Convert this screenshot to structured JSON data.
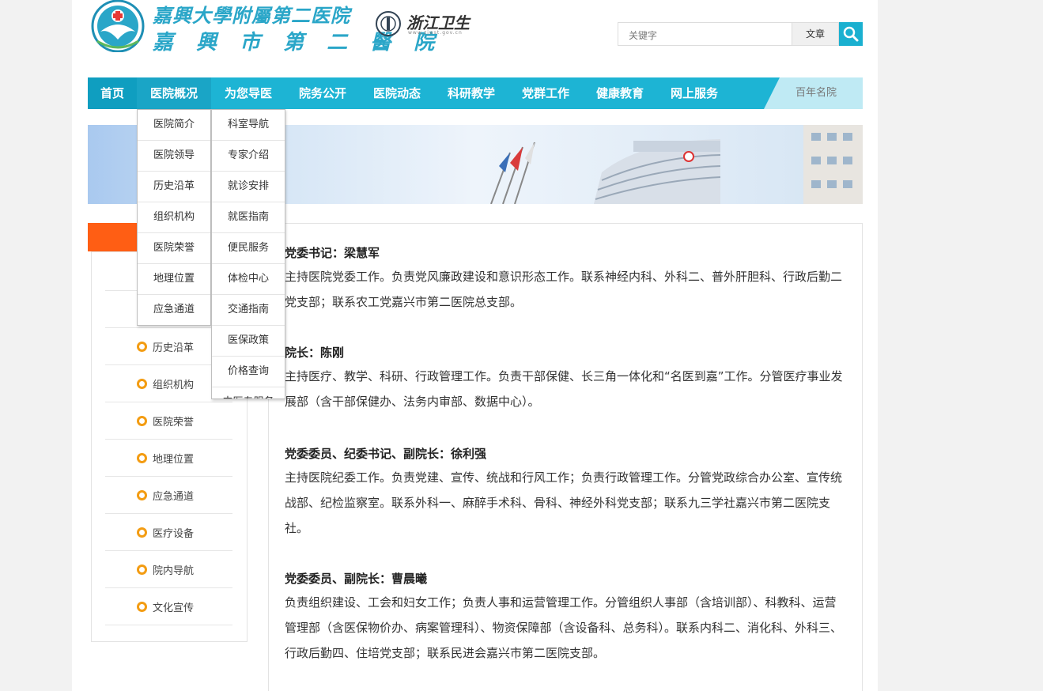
{
  "header": {
    "title_line1": "嘉興大學附屬第二医院",
    "title_line2": "嘉 興 市 第 二 醫 院",
    "partner_logo": "浙江卫生",
    "partner_sub": "www.zjwst.gov.cn",
    "search_placeholder": "关键字",
    "search_type": "文章"
  },
  "nav": {
    "items": [
      "首页",
      "医院概况",
      "为您导医",
      "院务公开",
      "医院动态",
      "科研教学",
      "党群工作",
      "健康教育",
      "网上服务"
    ],
    "slogan": "百年名院"
  },
  "dropdown_overview": [
    "医院简介",
    "医院领导",
    "历史沿革",
    "组织机构",
    "医院荣誉",
    "地理位置",
    "应急通道"
  ],
  "dropdown_guide": [
    "科室导航",
    "专家介绍",
    "就诊安排",
    "就医指南",
    "便民服务",
    "体检中心",
    "交通指南",
    "医保政策",
    "价格查询",
    "中医专服务"
  ],
  "sidebar": {
    "items": [
      "历史沿革",
      "组织机构",
      "医院荣誉",
      "地理位置",
      "应急通道",
      "医疗设备",
      "院内导航",
      "文化宣传"
    ]
  },
  "content": {
    "sections": [
      {
        "title": "党委书记：梁慧军",
        "body": "主持医院党委工作。负责党风廉政建设和意识形态工作。联系神经内科、外科二、普外肝胆科、行政后勤二党支部；联系农工党嘉兴市第二医院总支部。"
      },
      {
        "title": "院长：陈刚",
        "body": "主持医疗、教学、科研、行政管理工作。负责干部保健、长三角一体化和“名医到嘉”工作。分管医疗事业发展部（含干部保健办、法务内审部、数据中心）。"
      },
      {
        "title": "党委委员、纪委书记、副院长：徐利强",
        "body": "主持医院纪委工作。负责党建、宣传、统战和行风工作；负责行政管理工作。分管党政综合办公室、宣传统战部、纪检监察室。联系外科一、麻醉手术科、骨科、神经外科党支部；联系九三学社嘉兴市第二医院支社。"
      },
      {
        "title": "党委委员、副院长：曹晨曦",
        "body": "负责组织建设、工会和妇女工作；负责人事和运营管理工作。分管组织人事部（含培训部）、科教科、运营管理部（含医保物价办、病案管理科）、物资保障部（含设备科、总务科）。联系内科二、消化科、外科三、行政后勤四、住培党支部；联系民进会嘉兴市第二医院支部。"
      }
    ]
  },
  "colors": {
    "nav": "#1db4d4",
    "nav_home": "#0f9ec0",
    "sidebar_head": "#ff5e14",
    "bullet": "#f39c12"
  }
}
